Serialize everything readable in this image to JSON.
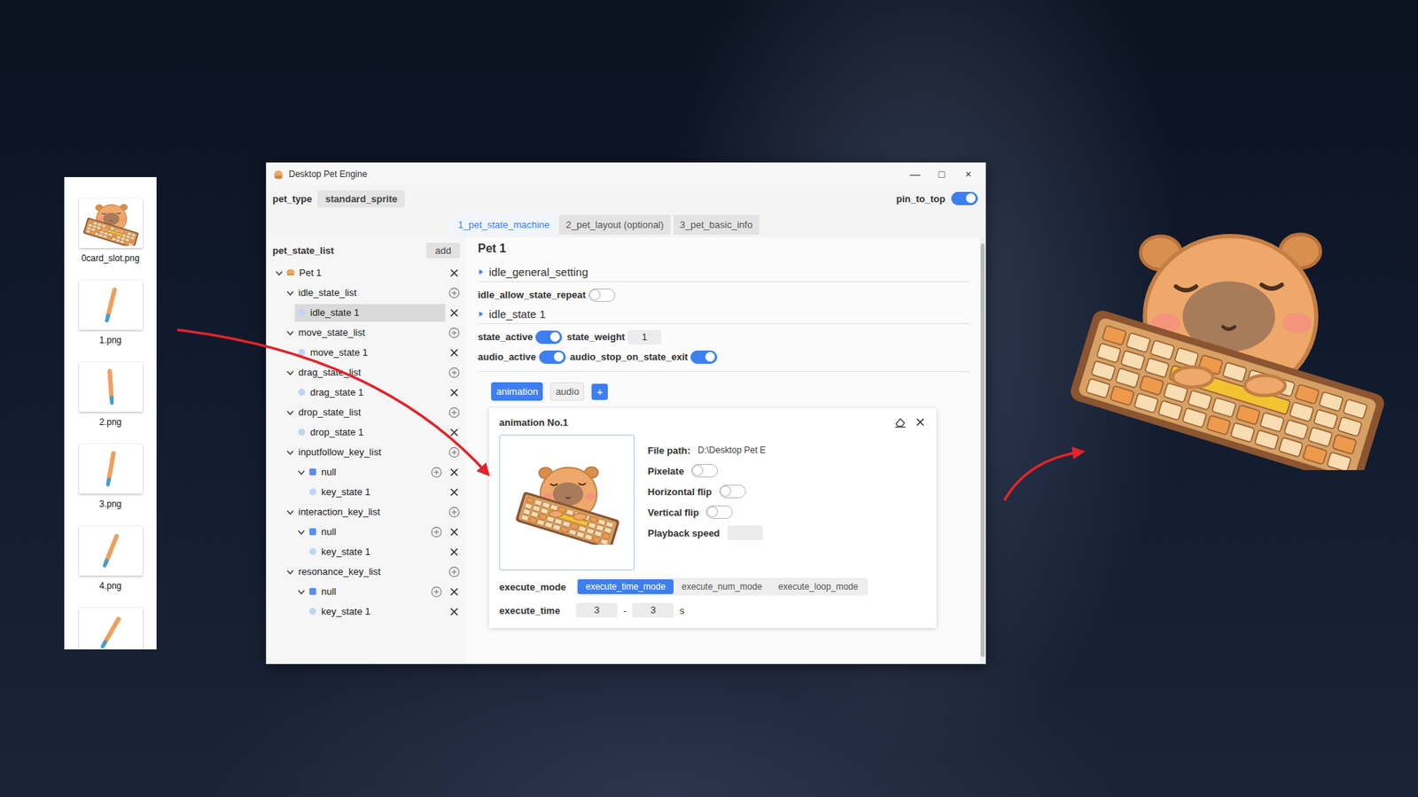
{
  "file_list": {
    "files": [
      {
        "name": "0card_slot.png",
        "kind": "image"
      },
      {
        "name": "1.png",
        "kind": "stroke"
      },
      {
        "name": "2.png",
        "kind": "stroke"
      },
      {
        "name": "3.png",
        "kind": "stroke"
      },
      {
        "name": "4.png",
        "kind": "stroke"
      },
      {
        "kind": "stroke"
      }
    ]
  },
  "window": {
    "title": "Desktop Pet Engine",
    "controls": [
      "—",
      "□",
      "×"
    ]
  },
  "toolbar": {
    "pet_type_label": "pet_type",
    "pet_type_value": "standard_sprite",
    "pin_label": "pin_to_top",
    "pin_on": true
  },
  "tabs": [
    {
      "label": "1_pet_state_machine",
      "selected": true
    },
    {
      "label": "2_pet_layout (optional)",
      "selected": false
    },
    {
      "label": "3_pet_basic_info",
      "selected": false
    }
  ],
  "tree": {
    "header": "pet_state_list",
    "add_button": "add",
    "items": [
      {
        "label": "Pet 1",
        "level": 0,
        "kind": "pet",
        "expanded": true,
        "selected": false,
        "can_add": false,
        "can_remove": true
      },
      {
        "label": "idle_state_list",
        "level": 1,
        "kind": "list",
        "expanded": true,
        "selected": false,
        "can_add": true,
        "can_remove": false
      },
      {
        "label": "idle_state 1",
        "level": 2,
        "kind": "state",
        "expanded": false,
        "selected": true,
        "can_add": false,
        "can_remove": true
      },
      {
        "label": "move_state_list",
        "level": 1,
        "kind": "list",
        "expanded": true,
        "selected": false,
        "can_add": true,
        "can_remove": false
      },
      {
        "label": "move_state 1",
        "level": 2,
        "kind": "state",
        "expanded": false,
        "selected": false,
        "can_add": false,
        "can_remove": true
      },
      {
        "label": "drag_state_list",
        "level": 1,
        "kind": "list",
        "expanded": true,
        "selected": false,
        "can_add": true,
        "can_remove": false
      },
      {
        "label": "drag_state 1",
        "level": 2,
        "kind": "state",
        "expanded": false,
        "selected": false,
        "can_add": false,
        "can_remove": true
      },
      {
        "label": "drop_state_list",
        "level": 1,
        "kind": "list",
        "expanded": true,
        "selected": false,
        "can_add": true,
        "can_remove": false
      },
      {
        "label": "drop_state 1",
        "level": 2,
        "kind": "state",
        "expanded": false,
        "selected": false,
        "can_add": false,
        "can_remove": true
      },
      {
        "label": "inputfollow_key_list",
        "level": 1,
        "kind": "list",
        "expanded": true,
        "selected": false,
        "can_add": true,
        "can_remove": false
      },
      {
        "label": "null",
        "level": 2,
        "kind": "group",
        "expanded": true,
        "selected": false,
        "can_add": true,
        "can_remove": true
      },
      {
        "label": "key_state 1",
        "level": 3,
        "kind": "state",
        "expanded": false,
        "selected": false,
        "can_add": false,
        "can_remove": true
      },
      {
        "label": "interaction_key_list",
        "level": 1,
        "kind": "list",
        "expanded": true,
        "selected": false,
        "can_add": true,
        "can_remove": false
      },
      {
        "label": "null",
        "level": 2,
        "kind": "group",
        "expanded": true,
        "selected": false,
        "can_add": true,
        "can_remove": true
      },
      {
        "label": "key_state 1",
        "level": 3,
        "kind": "state",
        "expanded": false,
        "selected": false,
        "can_add": false,
        "can_remove": true
      },
      {
        "label": "resonance_key_list",
        "level": 1,
        "kind": "list",
        "expanded": true,
        "selected": false,
        "can_add": true,
        "can_remove": false
      },
      {
        "label": "null",
        "level": 2,
        "kind": "group",
        "expanded": true,
        "selected": false,
        "can_add": true,
        "can_remove": true
      },
      {
        "label": "key_state 1",
        "level": 3,
        "kind": "state",
        "expanded": false,
        "selected": false,
        "can_add": false,
        "can_remove": true
      }
    ]
  },
  "editor": {
    "title": "Pet 1",
    "general_section": {
      "label": "idle_general_setting",
      "fields": [
        {
          "label": "idle_allow_state_repeat",
          "kind": "toggle",
          "on": false
        }
      ]
    },
    "state_section": {
      "label": "idle_state 1",
      "rows": [
        [
          {
            "label": "state_active",
            "kind": "toggle",
            "on": true
          },
          {
            "label": "state_weight",
            "kind": "number",
            "value": "1"
          }
        ],
        [
          {
            "label": "audio_active",
            "kind": "toggle",
            "on": true
          },
          {
            "label": "audio_stop_on_state_exit",
            "kind": "toggle",
            "on": true
          }
        ]
      ]
    },
    "subtabs": [
      {
        "label": "animation",
        "selected": true
      },
      {
        "label": "audio",
        "selected": false
      }
    ],
    "add_subtab": "+",
    "animation_card": {
      "title": "animation No.1",
      "file_path_label": "File path:",
      "file_path": "D:\\Desktop Pet E",
      "options": [
        {
          "label": "Pixelate",
          "kind": "toggle",
          "on": false
        },
        {
          "label": "Horizontal flip",
          "kind": "toggle",
          "on": false
        },
        {
          "label": "Vertical flip",
          "kind": "toggle",
          "on": false
        },
        {
          "label": "Playback speed",
          "kind": "input",
          "value": ""
        }
      ],
      "execute_mode_label": "execute_mode",
      "modes": [
        {
          "label": "execute_time_mode",
          "selected": true
        },
        {
          "label": "execute_num_mode",
          "selected": false
        },
        {
          "label": "execute_loop_mode",
          "selected": false
        }
      ],
      "execute_time_label": "execute_time",
      "time_from": "3",
      "time_separator": "-",
      "time_to": "3",
      "time_unit": "s"
    }
  }
}
